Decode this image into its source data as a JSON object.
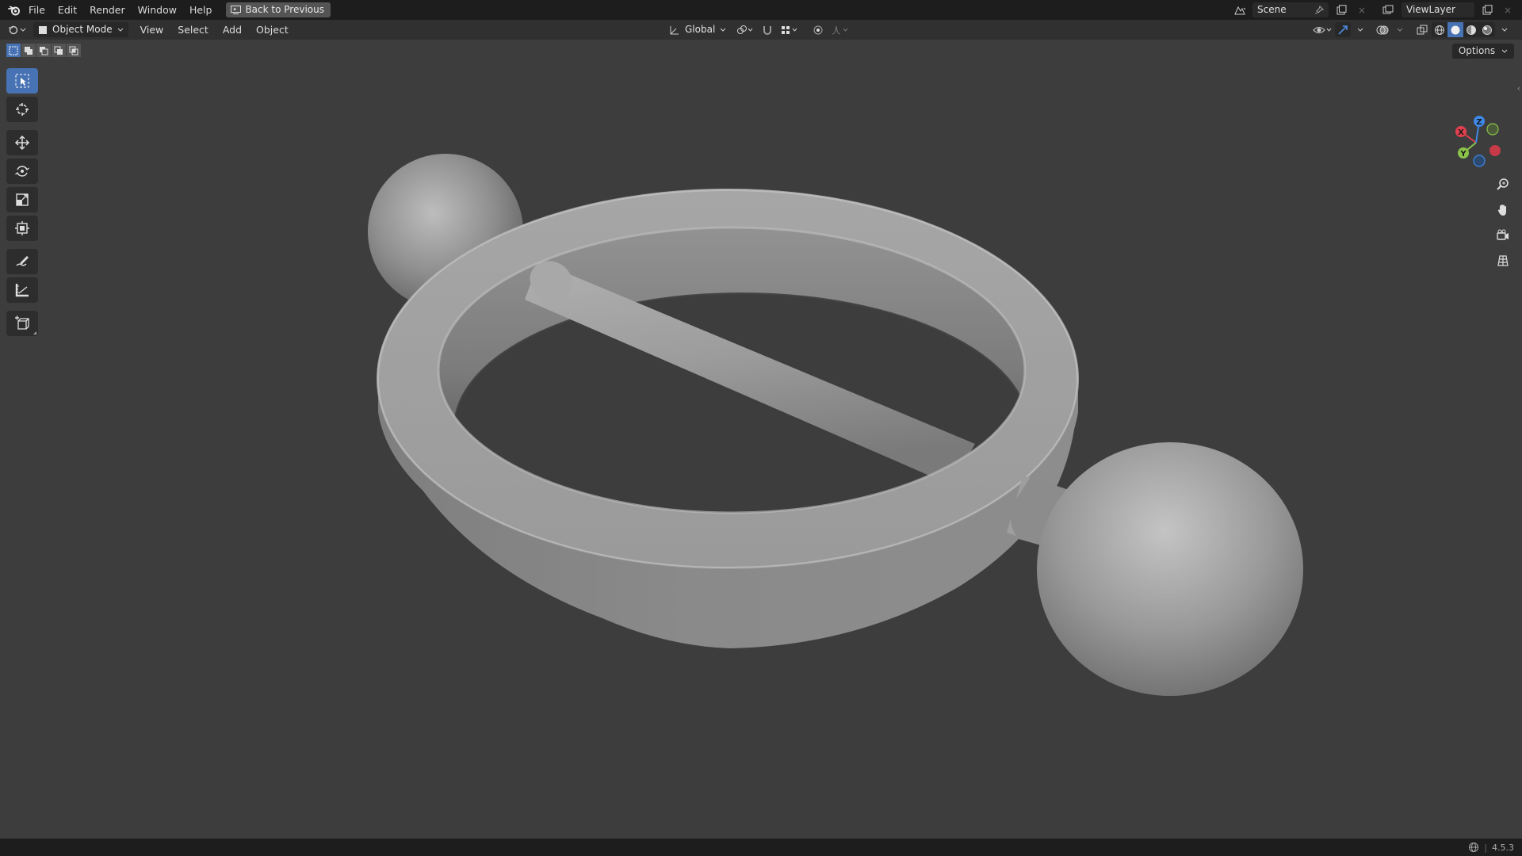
{
  "topbar": {
    "menu": [
      "File",
      "Edit",
      "Render",
      "Window",
      "Help"
    ],
    "back_button": "Back to Previous",
    "scene_label": "Scene",
    "view_layer_label": "ViewLayer"
  },
  "header": {
    "mode": "Object Mode",
    "menu": [
      "View",
      "Select",
      "Add",
      "Object"
    ],
    "transform_orientation": "Global",
    "options_label": "Options"
  },
  "toolbar": {
    "tools": [
      "select-box",
      "cursor",
      "move",
      "rotate",
      "scale",
      "transform",
      "annotate",
      "measure",
      "add-cube"
    ],
    "active": "select-box"
  },
  "gizmo": {
    "axes": [
      "X",
      "Y",
      "Z"
    ],
    "colors": {
      "x": "#e0404e",
      "y": "#8bc34a",
      "z": "#3d88e8"
    }
  },
  "statusbar": {
    "version": "4.5.3"
  },
  "colors": {
    "accent": "#4772b3",
    "viewport_bg": "#3d3d3d",
    "topbar_bg": "#1d1d1d"
  }
}
